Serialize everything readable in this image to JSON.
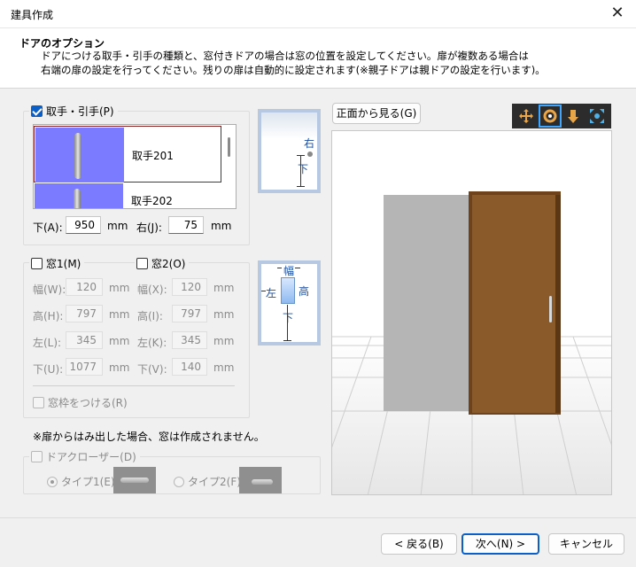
{
  "window": {
    "title": "建具作成",
    "close_glyph": "✕"
  },
  "header": {
    "title": "ドアのオプション",
    "desc_line1": "ドアにつける取手・引手の種類と、窓付きドアの場合は窓の位置を設定してください。扉が複数ある場合は",
    "desc_line2": "右端の扉の設定を行ってください。残りの扉は自動的に設定されます(※親子ドアは親ドアの設定を行います)。"
  },
  "handle_group": {
    "label": "取手・引手(P)",
    "checked": true,
    "items": [
      {
        "label": "取手201",
        "selected": true
      },
      {
        "label": "取手202",
        "selected": false
      }
    ],
    "bottom_label": "下(A):",
    "bottom_value": "950",
    "right_label": "右(J):",
    "right_value": "75",
    "unit": "mm"
  },
  "handle_preview": {
    "right_label": "右",
    "bottom_label": "下"
  },
  "window_group": {
    "window1_label": "窓1(M)",
    "window2_label": "窓2(O)",
    "unit": "mm",
    "window1_fields": [
      {
        "label": "幅(W):",
        "value": "120"
      },
      {
        "label": "高(H):",
        "value": "797"
      },
      {
        "label": "左(L):",
        "value": "345"
      },
      {
        "label": "下(U):",
        "value": "1077"
      }
    ],
    "window2_fields": [
      {
        "label": "幅(X):",
        "value": "120"
      },
      {
        "label": "高(I):",
        "value": "797"
      },
      {
        "label": "左(K):",
        "value": "345"
      },
      {
        "label": "下(V):",
        "value": "140"
      }
    ],
    "frame_label": "窓枠をつける(R)"
  },
  "window_preview": {
    "width_label": "幅",
    "height_label": "高",
    "left_label": "左",
    "bottom_label": "下"
  },
  "note": "※扉からはみ出した場合、窓は作成されません。",
  "closer_group": {
    "label": "ドアクローザー(D)",
    "type1_label": "タイプ1(E)",
    "type2_label": "タイプ2(F)"
  },
  "view": {
    "front_button": "正面から見る(G)",
    "toolbar_icons": [
      "move-icon",
      "rotate-icon",
      "zoom-icon",
      "fit-icon"
    ]
  },
  "footer": {
    "back_label": "< 戻る(B)",
    "next_label": "次へ(N) >",
    "cancel_label": "キャンセル"
  },
  "colors": {
    "accent": "#0a5fc9",
    "door": "#8b5a2b",
    "wall": "#b5b5b5",
    "handle_thumb_bg": "#7b7bff"
  }
}
